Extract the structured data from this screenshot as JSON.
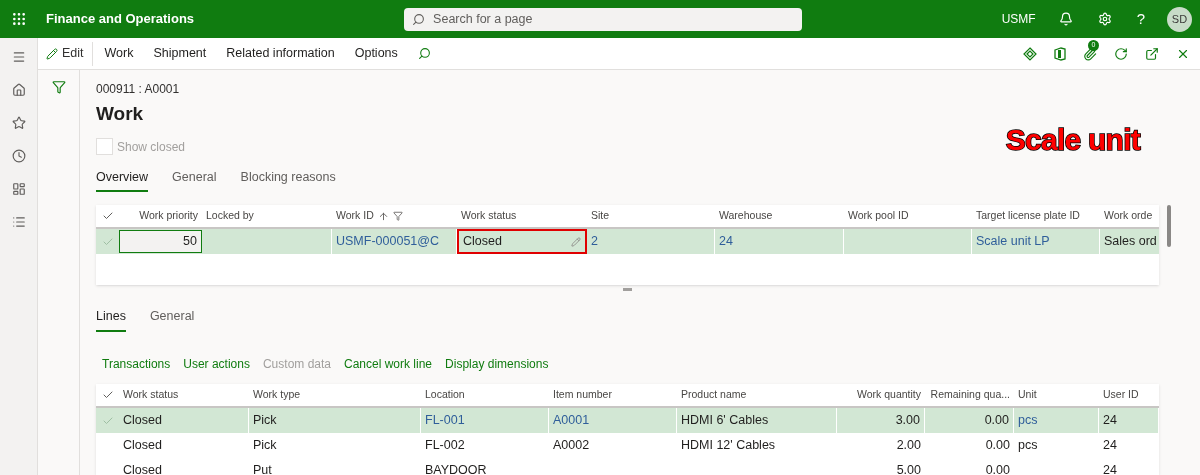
{
  "top_bar": {
    "app_title": "Finance and Operations",
    "search": {
      "placeholder": "Search for a page"
    },
    "company": "USMF",
    "help_glyph": "?",
    "avatar": "SD"
  },
  "action_bar": {
    "edit": "Edit",
    "menus": [
      "Work",
      "Shipment",
      "Related information",
      "Options"
    ],
    "attachments_count": "0"
  },
  "page": {
    "breadcrumb": "000911 : A0001",
    "title": "Work",
    "show_closed": {
      "label": "Show closed",
      "checked": false,
      "disabled": true
    },
    "annotation": "Scale unit",
    "tabs": [
      {
        "label": "Overview",
        "selected": true
      },
      {
        "label": "General",
        "selected": false
      },
      {
        "label": "Blocking reasons",
        "selected": false
      }
    ]
  },
  "header_grid": {
    "columns": [
      {
        "label": "Work priority"
      },
      {
        "label": "Locked by"
      },
      {
        "label": "Work ID",
        "sorted": true,
        "filtered": true
      },
      {
        "label": "Work status"
      },
      {
        "label": "Site"
      },
      {
        "label": "Warehouse"
      },
      {
        "label": "Work pool ID"
      },
      {
        "label": "Target license plate ID"
      },
      {
        "label": "Work orde"
      }
    ],
    "rows": [
      {
        "selected": true,
        "cells": [
          {
            "kind": "input",
            "text": "50"
          },
          {
            "kind": "text"
          },
          {
            "kind": "link",
            "text": "USMF-000051@C"
          },
          {
            "kind": "edit",
            "text": "Closed",
            "highlighted": true
          },
          {
            "kind": "link",
            "text": "2"
          },
          {
            "kind": "link",
            "text": "24"
          },
          {
            "kind": "text"
          },
          {
            "kind": "link",
            "text": "Scale unit LP"
          },
          {
            "kind": "text",
            "text": "Sales ord"
          }
        ]
      }
    ]
  },
  "lines": {
    "tabs": [
      {
        "label": "Lines",
        "selected": true
      },
      {
        "label": "General",
        "selected": false
      }
    ],
    "actions": [
      {
        "label": "Transactions",
        "disabled": false
      },
      {
        "label": "User actions",
        "disabled": false
      },
      {
        "label": "Custom data",
        "disabled": true
      },
      {
        "label": "Cancel work line",
        "disabled": false
      },
      {
        "label": "Display dimensions",
        "disabled": false
      }
    ],
    "columns": [
      {
        "label": "Work status"
      },
      {
        "label": "Work type"
      },
      {
        "label": "Location"
      },
      {
        "label": "Item number"
      },
      {
        "label": "Product name"
      },
      {
        "label": "Work quantity"
      },
      {
        "label": "Remaining qua..."
      },
      {
        "label": "Unit"
      },
      {
        "label": "User ID"
      }
    ],
    "rows": [
      {
        "selected": true,
        "cells": [
          {
            "kind": "text",
            "text": "Closed"
          },
          {
            "kind": "text",
            "text": "Pick"
          },
          {
            "kind": "link",
            "text": "FL-001"
          },
          {
            "kind": "link",
            "text": "A0001"
          },
          {
            "kind": "text",
            "text": "HDMI 6' Cables"
          },
          {
            "kind": "text",
            "text": "3.00"
          },
          {
            "kind": "text",
            "text": "0.00"
          },
          {
            "kind": "link",
            "text": "pcs"
          },
          {
            "kind": "text",
            "text": "24"
          }
        ]
      },
      {
        "selected": false,
        "cells": [
          {
            "kind": "text",
            "text": "Closed"
          },
          {
            "kind": "text",
            "text": "Pick"
          },
          {
            "kind": "text",
            "text": "FL-002"
          },
          {
            "kind": "text",
            "text": "A0002"
          },
          {
            "kind": "text",
            "text": "HDMI 12' Cables"
          },
          {
            "kind": "text",
            "text": "2.00"
          },
          {
            "kind": "text",
            "text": "0.00"
          },
          {
            "kind": "text",
            "text": "pcs"
          },
          {
            "kind": "text",
            "text": "24"
          }
        ]
      },
      {
        "selected": false,
        "cells": [
          {
            "kind": "text",
            "text": "Closed"
          },
          {
            "kind": "text",
            "text": "Put"
          },
          {
            "kind": "text",
            "text": "BAYDOOR"
          },
          {
            "kind": "text"
          },
          {
            "kind": "text"
          },
          {
            "kind": "text",
            "text": "5.00"
          },
          {
            "kind": "text",
            "text": "0.00"
          },
          {
            "kind": "text"
          },
          {
            "kind": "text",
            "text": "24"
          }
        ]
      }
    ]
  }
}
